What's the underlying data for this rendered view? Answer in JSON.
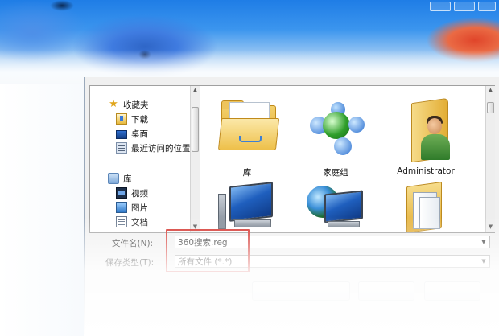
{
  "navigation": {
    "items": [
      {
        "label": "收藏夹",
        "icon": "star-icon"
      },
      {
        "label": "下载",
        "icon": "downloads-icon"
      },
      {
        "label": "桌面",
        "icon": "desktop-icon"
      },
      {
        "label": "最近访问的位置",
        "icon": "recent-places-icon"
      },
      {
        "label": "库",
        "icon": "library-icon"
      },
      {
        "label": "视频",
        "icon": "videos-icon"
      },
      {
        "label": "图片",
        "icon": "pictures-icon"
      },
      {
        "label": "文档",
        "icon": "documents-icon"
      }
    ]
  },
  "content": {
    "items": [
      {
        "label": "库",
        "icon": "libraries-folder-icon"
      },
      {
        "label": "家庭组",
        "icon": "homegroup-icon"
      },
      {
        "label": "Administrator",
        "icon": "user-folder-icon"
      },
      {
        "label": "",
        "icon": "computer-icon"
      },
      {
        "label": "",
        "icon": "network-icon"
      },
      {
        "label": "",
        "icon": "folder-icon"
      }
    ]
  },
  "form": {
    "filename_label": "文件名(N):",
    "filename_value": "360搜索.reg",
    "filetype_label": "保存类型(T):",
    "filetype_value": "所有文件 (*.*)"
  },
  "colors": {
    "highlight": "#d3302a",
    "titlebar": "#1f7de6"
  }
}
